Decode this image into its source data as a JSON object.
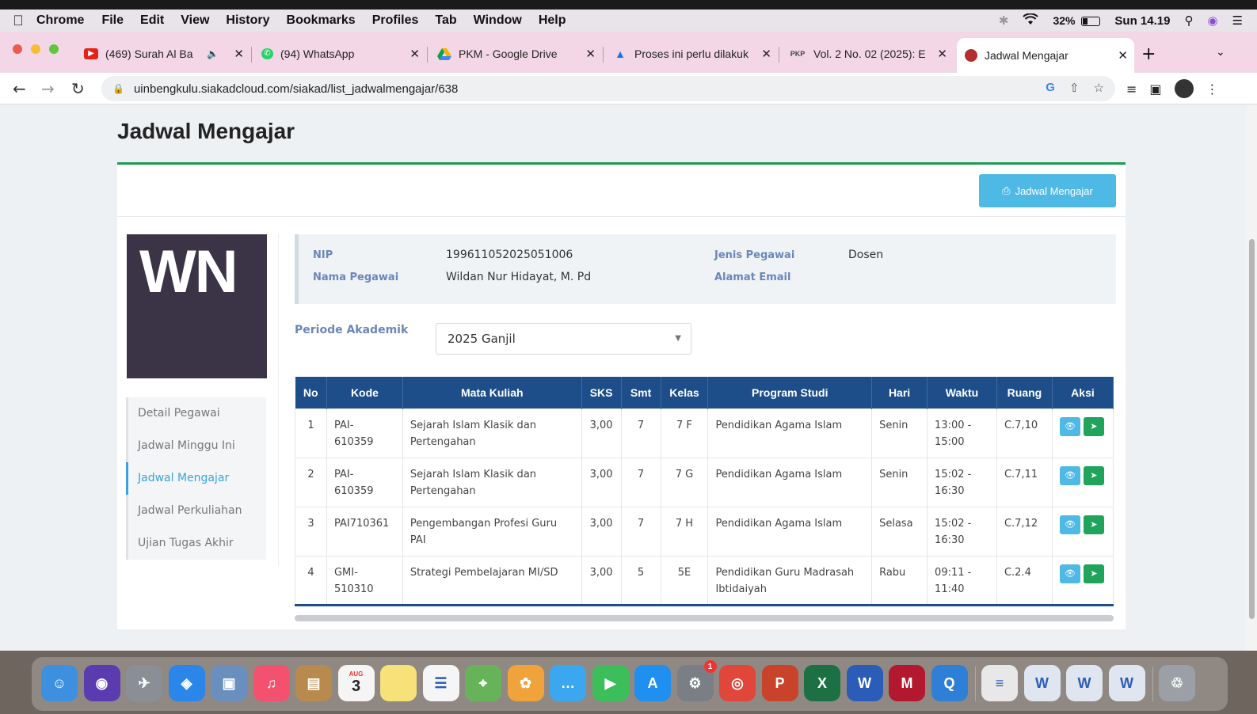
{
  "menubar": {
    "app": "Chrome",
    "items": [
      "File",
      "Edit",
      "View",
      "History",
      "Bookmarks",
      "Profiles",
      "Tab",
      "Window",
      "Help"
    ],
    "battery": "32%",
    "battery_fraction": 0.32,
    "clock": "Sun 14.19"
  },
  "tabs": [
    {
      "label": "(469) Surah Al Ba",
      "icon": "youtube-icon",
      "color": "#e62117"
    },
    {
      "label": "(94) WhatsApp",
      "icon": "whatsapp-icon",
      "color": "#25d366"
    },
    {
      "label": "PKM - Google Drive",
      "icon": "google-drive-icon",
      "color": "#f4b400"
    },
    {
      "label": "Proses ini perlu dilakuk",
      "icon": "graduation-cap-icon",
      "color": "#1a73e8"
    },
    {
      "label": "Vol. 2 No. 02 (2025): E",
      "icon": "pkp-icon",
      "color": "#444444"
    },
    {
      "label": "Jadwal Mengajar",
      "icon": "university-icon",
      "color": "#b52e2e"
    }
  ],
  "address": {
    "url": "uinbengkulu.siakadcloud.com/siakad/list_jadwalmengajar/638"
  },
  "page": {
    "title": "Jadwal Mengajar",
    "print_button": "Jadwal Mengajar",
    "photo_initials": "WN",
    "sidemenu": [
      "Detail Pegawai",
      "Jadwal Minggu Ini",
      "Jadwal Mengajar",
      "Jadwal Perkuliahan",
      "Ujian Tugas Akhir"
    ],
    "info": {
      "nip_label": "NIP",
      "nip": "199611052025051006",
      "nama_label": "Nama Pegawai",
      "nama": "Wildan Nur Hidayat, M. Pd",
      "jenis_label": "Jenis Pegawai",
      "jenis": "Dosen",
      "email_label": "Alamat Email",
      "email": ""
    },
    "periode_label": "Periode Akademik",
    "periode_value": "2025 Ganjil",
    "table": {
      "headers": [
        "No",
        "Kode",
        "Mata Kuliah",
        "SKS",
        "Smt",
        "Kelas",
        "Program Studi",
        "Hari",
        "Waktu",
        "Ruang",
        "Aksi"
      ],
      "rows": [
        {
          "no": "1",
          "kode": "PAI-\n610359",
          "matkul": "Sejarah Islam Klasik dan Pertengahan",
          "sks": "3,00",
          "smt": "7",
          "kelas": "7 F",
          "prodi": "Pendidikan Agama Islam",
          "hari": "Senin",
          "waktu": "13:00 -\n15:00",
          "ruang": "C.7,10"
        },
        {
          "no": "2",
          "kode": "PAI-\n610359",
          "matkul": "Sejarah Islam Klasik dan Pertengahan",
          "sks": "3,00",
          "smt": "7",
          "kelas": "7 G",
          "prodi": "Pendidikan Agama Islam",
          "hari": "Senin",
          "waktu": "15:02 -\n16:30",
          "ruang": "C.7,11"
        },
        {
          "no": "3",
          "kode": "PAI710361",
          "matkul": "Pengembangan Profesi Guru PAI",
          "sks": "3,00",
          "smt": "7",
          "kelas": "7 H",
          "prodi": "Pendidikan Agama Islam",
          "hari": "Selasa",
          "waktu": "15:02 -\n16:30",
          "ruang": "C.7,12"
        },
        {
          "no": "4",
          "kode": "GMI-\n510310",
          "matkul": "Strategi Pembelajaran MI/SD",
          "sks": "3,00",
          "smt": "5",
          "kelas": "5E",
          "prodi": "Pendidikan Guru Madrasah Ibtidaiyah",
          "hari": "Rabu",
          "waktu": "09:11 -\n11:40",
          "ruang": "C.2.4"
        }
      ]
    }
  },
  "dock": {
    "calendar_day": "3",
    "calendar_month": "AUG",
    "sysprefs_badge": "1",
    "apps": [
      {
        "name": "finder-icon",
        "color": "#3d8fe0"
      },
      {
        "name": "siri-icon",
        "color": "#5b3bb0"
      },
      {
        "name": "launchpad-icon",
        "color": "#8a8f96"
      },
      {
        "name": "safari-icon",
        "color": "#2a86e8"
      },
      {
        "name": "preview-icon",
        "color": "#6a8fbf"
      },
      {
        "name": "music-icon",
        "color": "#f2526e"
      },
      {
        "name": "notebook-icon",
        "color": "#b88a4e"
      },
      {
        "name": "calendar-icon",
        "color": "#f5f5f5"
      },
      {
        "name": "notes-icon",
        "color": "#f7e27a"
      },
      {
        "name": "reminders-icon",
        "color": "#f5f5f5"
      },
      {
        "name": "maps-icon",
        "color": "#67b35a"
      },
      {
        "name": "photos-icon",
        "color": "#f0a23b"
      },
      {
        "name": "messages-icon",
        "color": "#3aa7f0"
      },
      {
        "name": "facetime-icon",
        "color": "#3cbf5a"
      },
      {
        "name": "app-store-icon",
        "color": "#1f8ff0"
      },
      {
        "name": "system-preferences-icon",
        "color": "#7a7f86"
      },
      {
        "name": "chrome-icon",
        "color": "#e0463a"
      },
      {
        "name": "powerpoint-icon",
        "color": "#c9432a"
      },
      {
        "name": "excel-icon",
        "color": "#1d7044"
      },
      {
        "name": "word-icon",
        "color": "#2b5db8"
      },
      {
        "name": "mendeley-icon",
        "color": "#b3182e"
      },
      {
        "name": "quicktime-icon",
        "color": "#2f7fd6"
      },
      {
        "name": "document-icon",
        "color": "#e8e8e8"
      },
      {
        "name": "word-doc-icon",
        "color": "#dfe6ef"
      },
      {
        "name": "word-doc-icon",
        "color": "#dfe6ef"
      },
      {
        "name": "word-doc-icon",
        "color": "#dfe6ef"
      },
      {
        "name": "trash-icon",
        "color": "#9aa0a6"
      }
    ]
  },
  "colors": {
    "table_header": "#1d4e89",
    "accent_green": "#1d9a54",
    "button_blue": "#4fb9e6",
    "label_blue": "#6b86b8",
    "photo_bg": "#3a3446"
  }
}
